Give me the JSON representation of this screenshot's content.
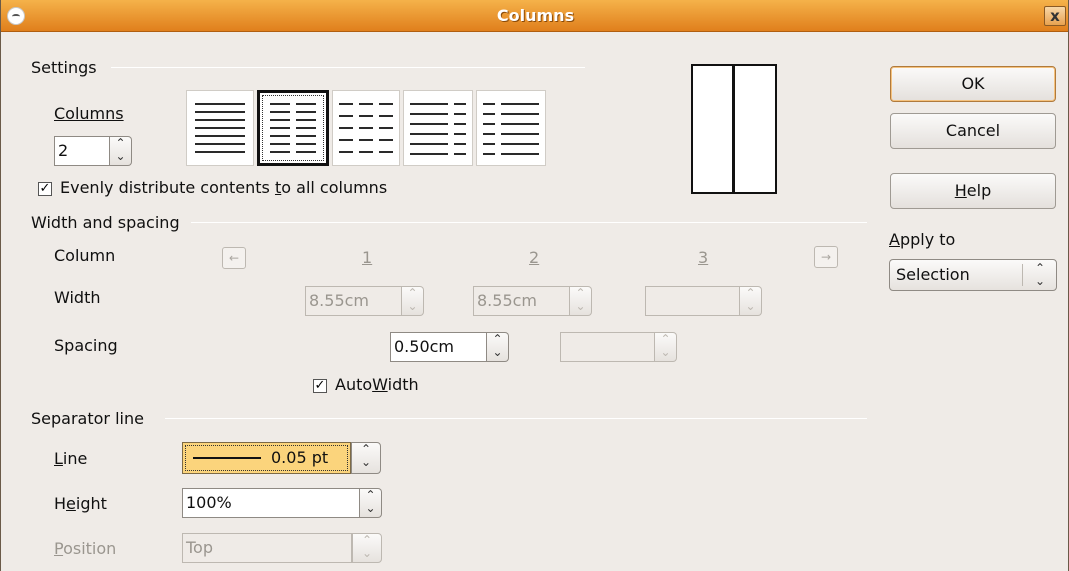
{
  "window": {
    "title": "Columns",
    "close_symbol": "x"
  },
  "settings": {
    "heading": "Settings",
    "columns_label": "Columns",
    "columns_value": "2",
    "evenly_label_pre": "Evenly distribute contents ",
    "evenly_label_u": "t",
    "evenly_label_post": "o all columns",
    "evenly_checked": "✓",
    "selected_preset": 2
  },
  "width_spacing": {
    "heading": "Width and spacing",
    "column_label": "Column",
    "col_numbers": [
      "1",
      "2",
      "3"
    ],
    "width_label": "Width",
    "widths": [
      "8.55cm",
      "8.55cm",
      ""
    ],
    "spacing_label": "Spacing",
    "spacings": [
      "0.50cm",
      ""
    ],
    "autowidth_pre": "Auto",
    "autowidth_u": "W",
    "autowidth_post": "idth",
    "autowidth_checked": "✓",
    "prev_arrow": "←",
    "next_arrow": "→"
  },
  "separator": {
    "heading": "Separator line",
    "line_label_u": "L",
    "line_label_rest": "ine",
    "line_value": "0.05 pt",
    "height_label_pre": "H",
    "height_label_u": "e",
    "height_label_post": "ight",
    "height_value": "100%",
    "position_label_u": "P",
    "position_label_rest": "osition",
    "position_value": "Top"
  },
  "buttons": {
    "ok": "OK",
    "cancel": "Cancel",
    "help_u": "H",
    "help_rest": "elp"
  },
  "apply_to": {
    "label_u": "A",
    "label_rest": "pply to",
    "value": "Selection"
  },
  "spin_up": "⌃",
  "spin_down": "⌄",
  "accent_color": "#e9871f",
  "highlight_color": "#fbd47c"
}
